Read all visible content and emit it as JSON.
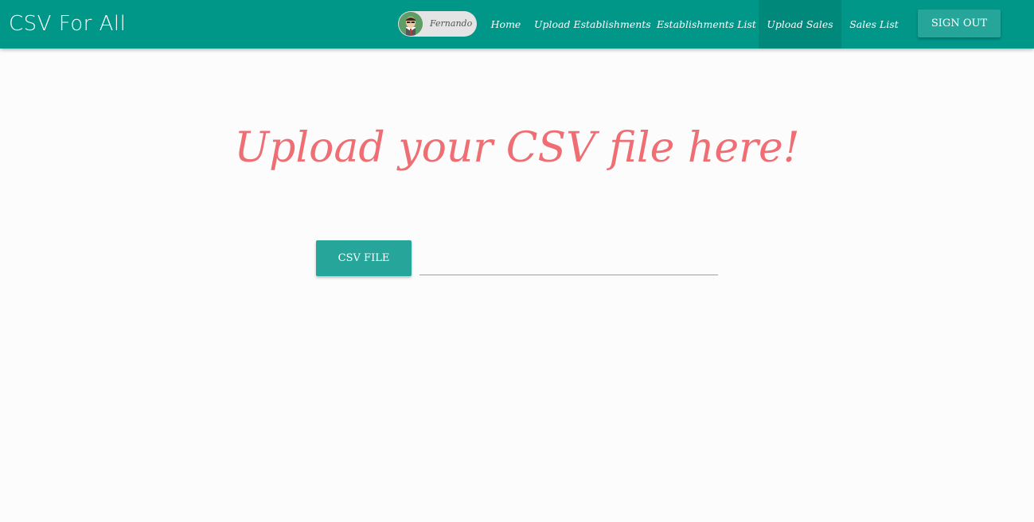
{
  "app": {
    "brand": "CSV For All"
  },
  "user": {
    "name": "Fernando",
    "avatar_icon": "user-avatar-icon"
  },
  "nav": {
    "items": [
      {
        "label": "Home",
        "active": false
      },
      {
        "label": "Upload Establishments",
        "active": false
      },
      {
        "label": "Establishments List",
        "active": false
      },
      {
        "label": "Upload Sales",
        "active": true
      },
      {
        "label": "Sales List",
        "active": false
      }
    ],
    "signout_label": "SIGN OUT"
  },
  "main": {
    "title": "Upload your CSV file here!",
    "file_button_label": "CSV FILE",
    "file_path_value": ""
  },
  "colors": {
    "navbar": "#009688",
    "navbar_active": "#00897b",
    "button": "#26a69a",
    "title": "#ee6e73",
    "background": "#fcfcfc"
  }
}
